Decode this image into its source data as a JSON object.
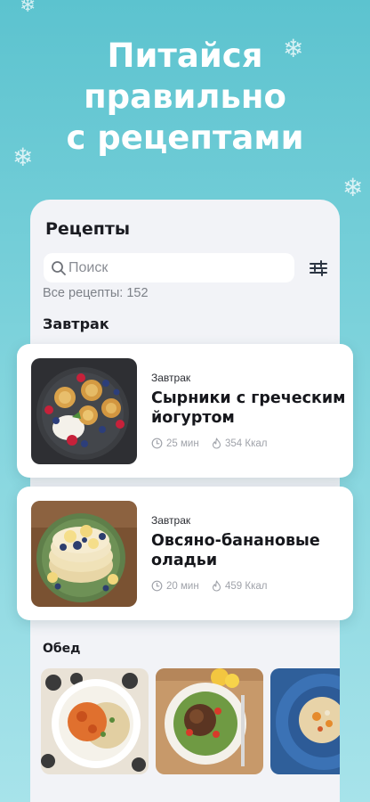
{
  "hero": {
    "line1": "Питайся",
    "line2": "правильно",
    "line3": "с рецептами"
  },
  "panel": {
    "title": "Рецепты",
    "search_placeholder": "Поиск",
    "count_text": "Все рецепты: 152"
  },
  "sections": {
    "breakfast": "Завтрак",
    "lunch": "Обед"
  },
  "recipes": [
    {
      "category": "Завтрак",
      "title": "Сырники с греческим йогуртом",
      "time": "25 мин",
      "kcal": "354 Ккал"
    },
    {
      "category": "Завтрак",
      "title": "Овсяно-банановые оладьи",
      "time": "20 мин",
      "kcal": "459 Ккал"
    }
  ],
  "icons": {
    "search": "search-icon",
    "filter": "sliders-icon",
    "time": "clock-icon",
    "kcal": "flame-icon",
    "decoration": "snowflake-icon"
  },
  "colors": {
    "background_top": "#5cc3cf",
    "background_bottom": "#a7e3ea",
    "panel": "#f2f3f7",
    "text_dark": "#16171c",
    "text_muted": "#a0a3aa"
  }
}
